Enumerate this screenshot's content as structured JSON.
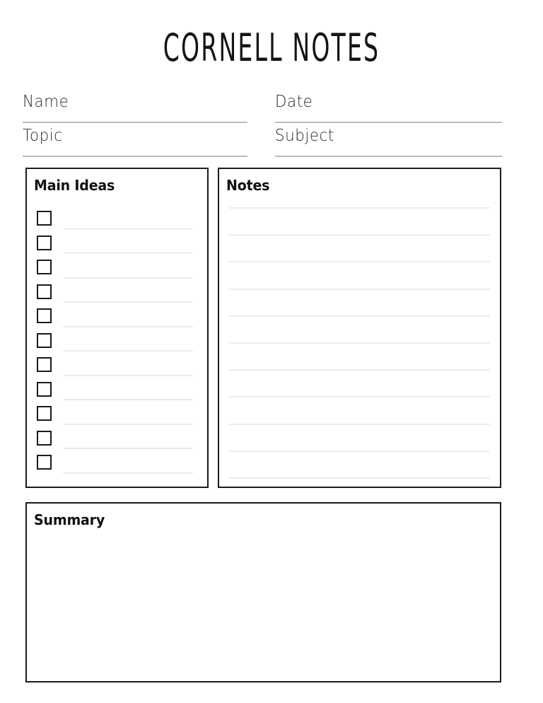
{
  "document": {
    "title": "CORNELL NOTES"
  },
  "header_fields": [
    {
      "label": "Name",
      "value": ""
    },
    {
      "label": "Date",
      "value": ""
    },
    {
      "label": "Topic",
      "value": ""
    },
    {
      "label": "Subject",
      "value": ""
    }
  ],
  "main_ideas": {
    "heading": "Main Ideas",
    "checkbox_count": 11,
    "items": [
      {
        "checked": false,
        "text": ""
      },
      {
        "checked": false,
        "text": ""
      },
      {
        "checked": false,
        "text": ""
      },
      {
        "checked": false,
        "text": ""
      },
      {
        "checked": false,
        "text": ""
      },
      {
        "checked": false,
        "text": ""
      },
      {
        "checked": false,
        "text": ""
      },
      {
        "checked": false,
        "text": ""
      },
      {
        "checked": false,
        "text": ""
      },
      {
        "checked": false,
        "text": ""
      },
      {
        "checked": false,
        "text": ""
      }
    ]
  },
  "notes": {
    "heading": "Notes",
    "line_count": 11,
    "lines": [
      "",
      "",
      "",
      "",
      "",
      "",
      "",
      "",
      "",
      "",
      ""
    ]
  },
  "summary": {
    "heading": "Summary",
    "text": ""
  },
  "colors": {
    "page_background": "#ffffff",
    "ink": "#1a1a1a",
    "box_border": "#1b1b1b",
    "field_rule": "#b9bbbd",
    "ruled_line": "#ececec"
  }
}
